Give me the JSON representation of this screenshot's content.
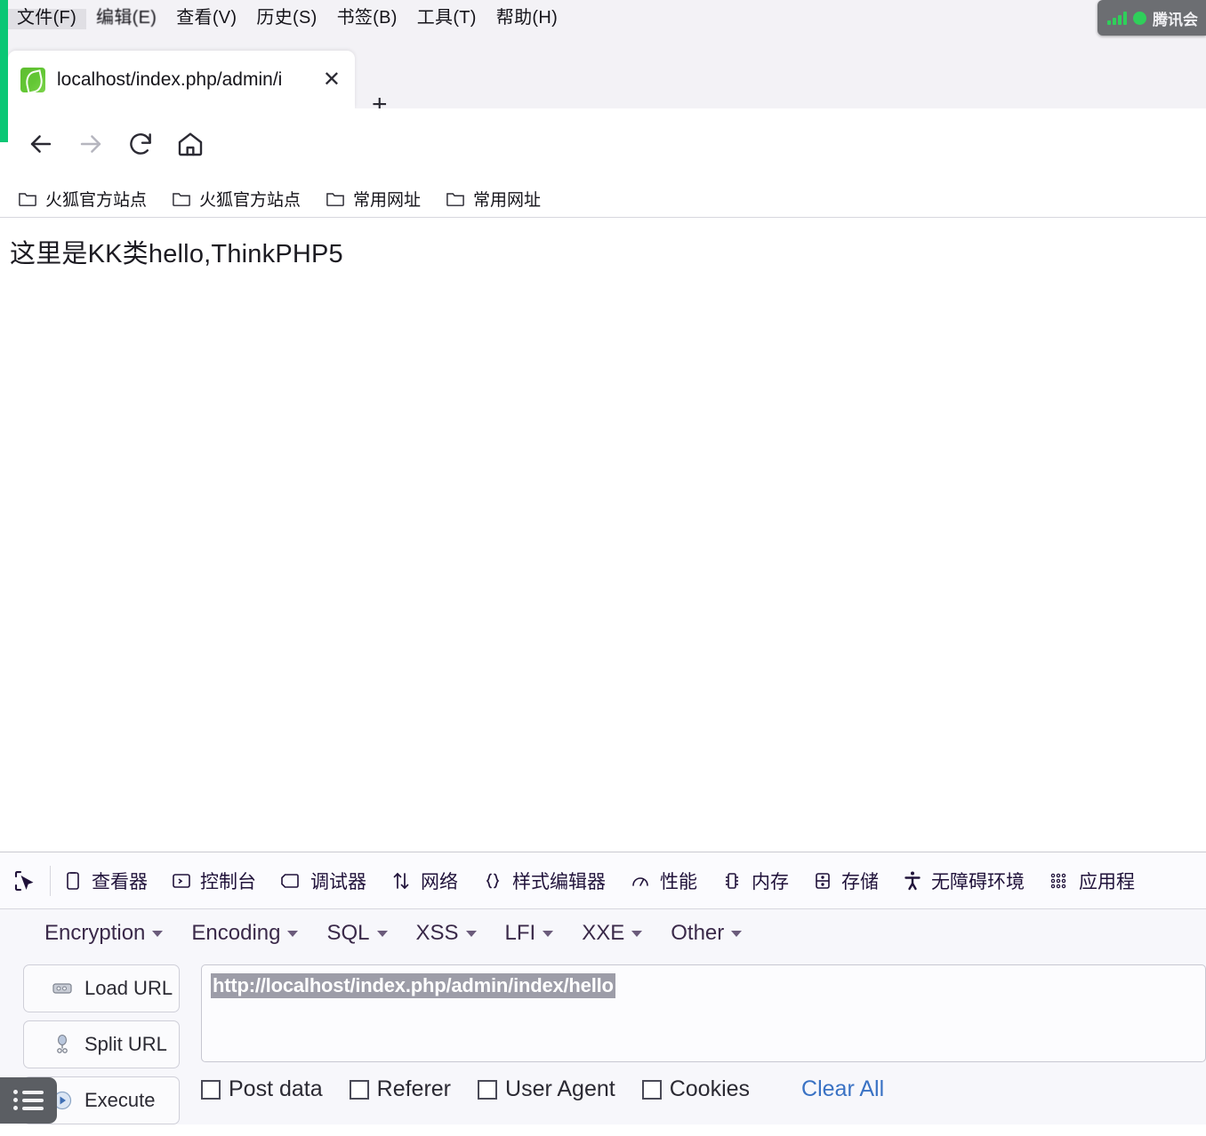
{
  "browser": {
    "menubar": [
      {
        "label": "文件(F)",
        "state": "active"
      },
      {
        "label": "编辑(E)",
        "state": "blurred"
      },
      {
        "label": "查看(V)",
        "state": "normal"
      },
      {
        "label": "历史(S)",
        "state": "normal"
      },
      {
        "label": "书签(B)",
        "state": "normal"
      },
      {
        "label": "工具(T)",
        "state": "normal"
      },
      {
        "label": "帮助(H)",
        "state": "normal"
      }
    ],
    "tab": {
      "title": "localhost/index.php/admin/i",
      "favicon": "thinkphp-leaf-icon",
      "close_label": "✕"
    },
    "newtab_label": "+",
    "nav": {
      "back": "back-arrow-icon",
      "forward": "forward-arrow-icon",
      "reload": "reload-icon",
      "home": "home-icon"
    },
    "url": {
      "host": "localhost",
      "path": "/index.php/admin/index/hello",
      "full": "localhost/index.php/admin/index/hello",
      "icons": [
        "shield-off-icon",
        "broken-lock-icon",
        "permissions-icon"
      ]
    },
    "bookmarks": [
      {
        "label": "火狐官方站点",
        "icon": "folder-icon"
      },
      {
        "label": "火狐官方站点",
        "icon": "folder-icon"
      },
      {
        "label": "常用网址",
        "icon": "folder-icon"
      },
      {
        "label": "常用网址",
        "icon": "folder-icon"
      }
    ]
  },
  "page": {
    "text": "这里是KK类hello,ThinkPHP5"
  },
  "devtools": {
    "picker_icon": "element-picker-icon",
    "tabs": [
      {
        "label": "查看器",
        "icon": "inspector-icon"
      },
      {
        "label": "控制台",
        "icon": "console-icon"
      },
      {
        "label": "调试器",
        "icon": "debugger-icon"
      },
      {
        "label": "网络",
        "icon": "network-icon"
      },
      {
        "label": "样式编辑器",
        "icon": "style-editor-icon"
      },
      {
        "label": "性能",
        "icon": "performance-icon"
      },
      {
        "label": "内存",
        "icon": "memory-icon"
      },
      {
        "label": "存储",
        "icon": "storage-icon"
      },
      {
        "label": "无障碍环境",
        "icon": "accessibility-icon"
      },
      {
        "label": "应用程",
        "icon": "application-icon"
      }
    ]
  },
  "hackbar": {
    "menu": [
      {
        "label": "Encryption"
      },
      {
        "label": "Encoding"
      },
      {
        "label": "SQL"
      },
      {
        "label": "XSS"
      },
      {
        "label": "LFI"
      },
      {
        "label": "XXE"
      },
      {
        "label": "Other"
      }
    ],
    "buttons": [
      {
        "label": "Load URL",
        "icon": "server-icon"
      },
      {
        "label": "Split URL",
        "icon": "split-icon"
      },
      {
        "label": "Execute",
        "icon": "play-icon"
      }
    ],
    "url_value": "http://localhost/index.php/admin/index/hello",
    "checkboxes": [
      {
        "label": "Post data",
        "checked": false
      },
      {
        "label": "Referer",
        "checked": false
      },
      {
        "label": "User Agent",
        "checked": false
      },
      {
        "label": "Cookies",
        "checked": false
      }
    ],
    "clear_all_label": "Clear All"
  },
  "overlays": {
    "tencent_label": "腾讯会",
    "taskbar_icon": "list-icon"
  },
  "colors": {
    "accent_green": "#0ac775",
    "link_blue": "#3a72c4",
    "chrome_bg": "#f3f2f6",
    "selection_grey": "#9d9da8"
  }
}
